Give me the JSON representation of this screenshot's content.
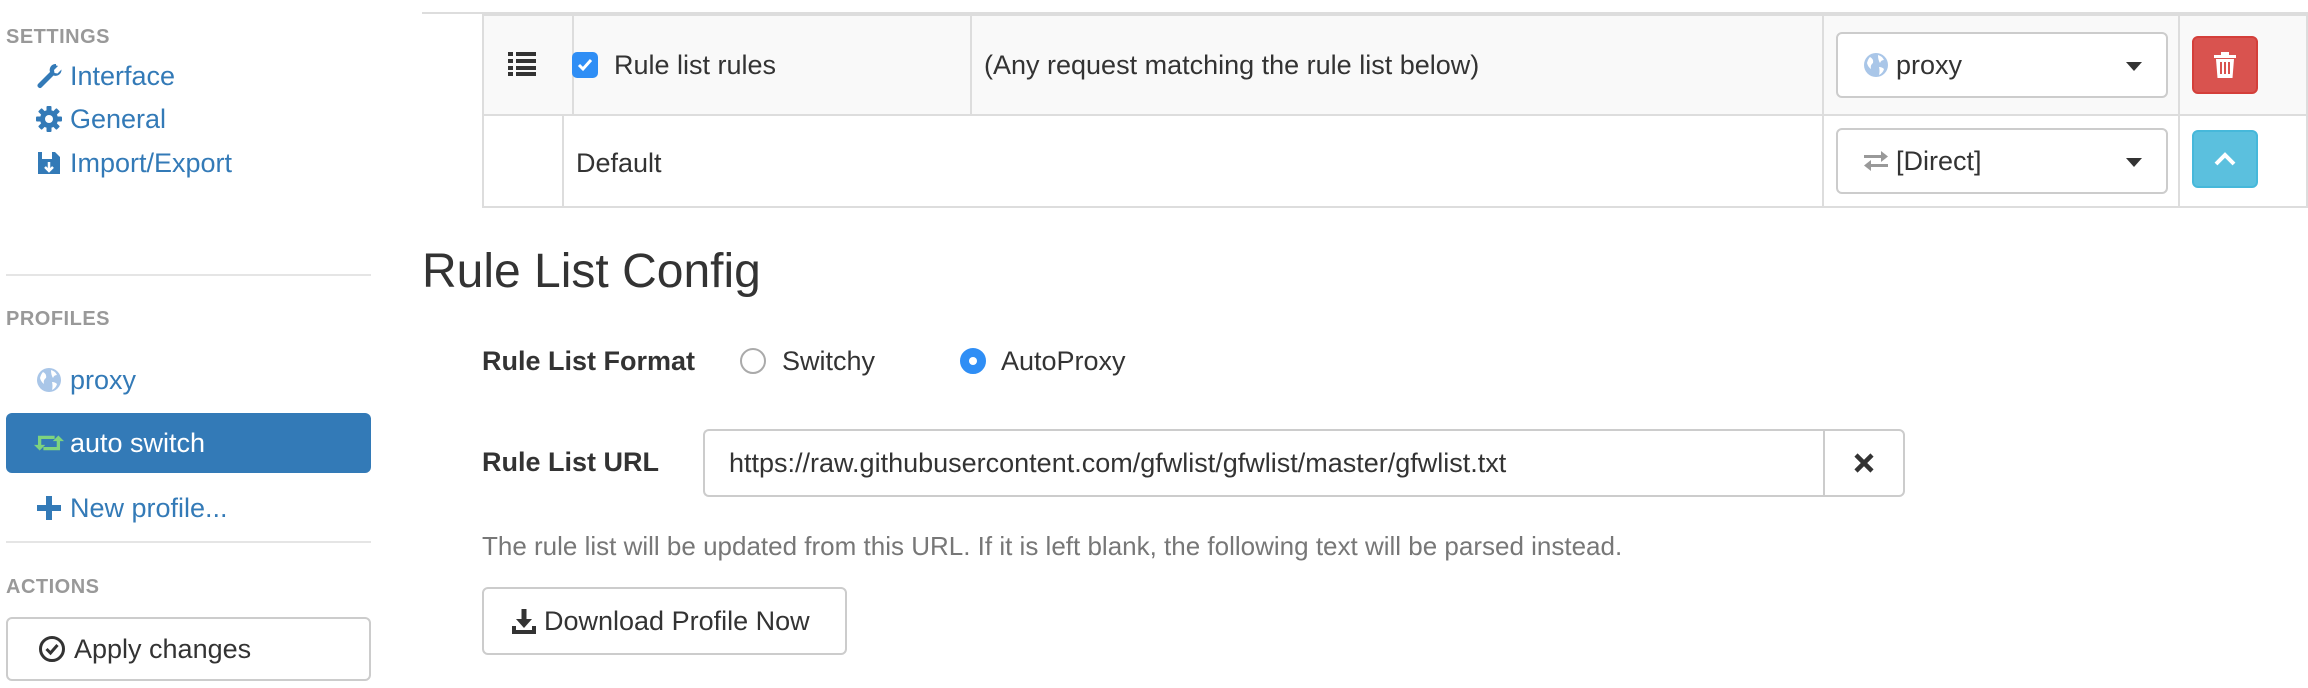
{
  "sidebar": {
    "settings_header": "SETTINGS",
    "settings_items": [
      {
        "label": "Interface",
        "icon": "wrench-icon"
      },
      {
        "label": "General",
        "icon": "gear-icon"
      },
      {
        "label": "Import/Export",
        "icon": "floppy-disk-icon"
      }
    ],
    "profiles_header": "PROFILES",
    "profile_items": [
      {
        "label": "proxy",
        "icon": "globe-icon",
        "active": false
      },
      {
        "label": "auto switch",
        "icon": "retweet-icon",
        "active": true
      },
      {
        "label": "New profile...",
        "icon": "plus-icon",
        "active": false
      }
    ],
    "actions_header": "ACTIONS",
    "apply_label": "Apply changes"
  },
  "rules_table": {
    "rows": [
      {
        "checked": true,
        "condition_type": "Rule list rules",
        "condition_details": "(Any request matching the rule list below)",
        "profile": "proxy",
        "profile_icon": "globe-icon"
      },
      {
        "condition_type": "Default",
        "profile": "[Direct]",
        "profile_icon": "transfer-icon"
      }
    ]
  },
  "rule_list_config": {
    "title": "Rule List Config",
    "format_label": "Rule List Format",
    "format_options": [
      "Switchy",
      "AutoProxy"
    ],
    "selected_format": "AutoProxy",
    "url_label": "Rule List URL",
    "url_value": "https://raw.githubusercontent.com/gfwlist/gfwlist/master/gfwlist.txt",
    "help_text": "The rule list will be updated from this URL. If it is left blank, the following text will be parsed instead.",
    "download_label": "Download Profile Now"
  },
  "colors": {
    "link": "#337ab7",
    "active_bg": "#337ab7",
    "danger": "#d9534f",
    "info": "#5bc0de",
    "radio_checked": "#2f8ef5",
    "muted_header": "#999999",
    "retweet_icon": "#7ed37e"
  }
}
